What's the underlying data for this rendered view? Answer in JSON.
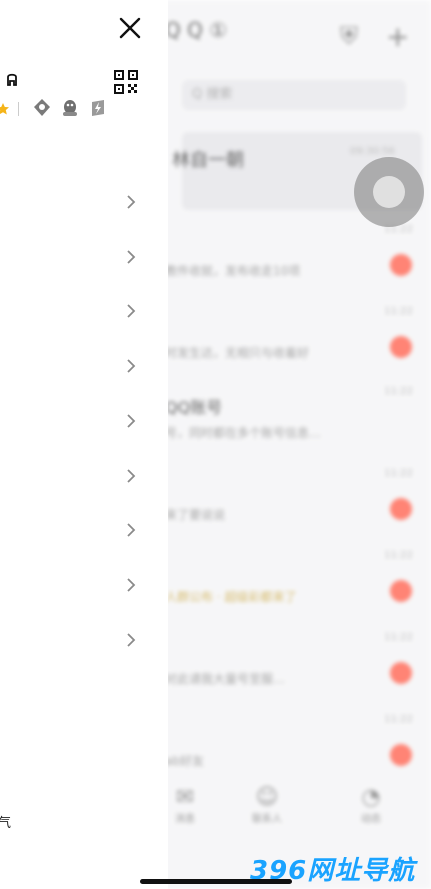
{
  "background": {
    "title": "Q Q ①",
    "search_placeholder": "Q 搜索",
    "pinned_label": "林自一朝",
    "pinned_time": "09:30:56",
    "chats": [
      {
        "name": "",
        "message": "教件收就，发布收走10项",
        "time": "11:22"
      },
      {
        "name": "",
        "message": "时发生达，无相只与收着好",
        "time": "11:22"
      },
      {
        "name": "QQ账号",
        "message": "号，同时都在多个账号信息…",
        "time": "11:22"
      },
      {
        "name": "",
        "message": "来了要说说",
        "time": "11:22"
      },
      {
        "name": "",
        "message": "人群公布  · 超级彩都来了",
        "time": "11:22"
      },
      {
        "name": "",
        "message": "对此请我大量号至服…",
        "time": "11:22"
      },
      {
        "name": "",
        "message": "ab好友",
        "time": "11:22"
      }
    ],
    "tabs": [
      {
        "icon": "chat-icon",
        "label": "消息"
      },
      {
        "icon": "contacts-icon",
        "label": "联系人"
      },
      {
        "icon": "moments-icon",
        "label": "动态"
      }
    ],
    "colors": {
      "unread": "#ff5b47",
      "assist": "#8a8a8a"
    }
  },
  "drawer": {
    "menu_items": [
      "",
      "",
      "",
      "",
      "",
      "",
      "",
      "",
      ""
    ],
    "settings_label": "气",
    "colors": {
      "background": "#ffffff",
      "chevron": "#8a8a8a"
    }
  },
  "watermark": "396网址导航"
}
